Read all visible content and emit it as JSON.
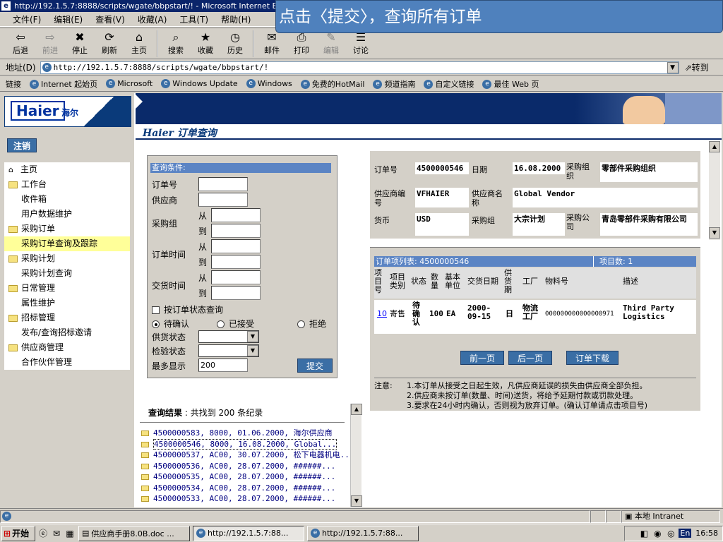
{
  "window": {
    "title": "http://192.1.5.7:8888/scripts/wgate/bbpstart/! - Microsoft Internet Explorer"
  },
  "callout": {
    "text": "点击〈提交〉，查询所有订单"
  },
  "menu": [
    "文件(F)",
    "编辑(E)",
    "查看(V)",
    "收藏(A)",
    "工具(T)",
    "帮助(H)"
  ],
  "toolbar": [
    {
      "label": "后退",
      "icon": "back-arrow-icon",
      "glyph": "⇦"
    },
    {
      "label": "前进",
      "icon": "forward-arrow-icon",
      "glyph": "⇨"
    },
    {
      "label": "停止",
      "icon": "stop-icon",
      "glyph": "✖"
    },
    {
      "label": "刷新",
      "icon": "refresh-icon",
      "glyph": "⟳"
    },
    {
      "label": "主页",
      "icon": "home-icon",
      "glyph": "⌂"
    },
    {
      "label": "搜索",
      "icon": "search-icon",
      "glyph": "⌕"
    },
    {
      "label": "收藏",
      "icon": "favorites-icon",
      "glyph": "★"
    },
    {
      "label": "历史",
      "icon": "history-icon",
      "glyph": "◷"
    },
    {
      "label": "邮件",
      "icon": "mail-icon",
      "glyph": "✉"
    },
    {
      "label": "打印",
      "icon": "print-icon",
      "glyph": "⎙"
    },
    {
      "label": "编辑",
      "icon": "edit-icon",
      "glyph": "✎"
    },
    {
      "label": "讨论",
      "icon": "discuss-icon",
      "glyph": "☰"
    }
  ],
  "address": {
    "label": "地址(D)",
    "url": "http://192.1.5.7:8888/scripts/wgate/bbpstart/!",
    "go": "转到"
  },
  "links": {
    "label": "链接",
    "items": [
      "Internet 起始页",
      "Microsoft",
      "Windows Update",
      "Windows",
      "免费的HotMail",
      "频道指南",
      "自定义链接",
      "最佳 Web 页"
    ]
  },
  "brand": {
    "logo": "Haier",
    "logo_cn": "海尔",
    "subtitle": "Haier 订单查询"
  },
  "sidebar": {
    "logout": "注销",
    "items": [
      {
        "label": "主页",
        "level": 0,
        "kind": "home"
      },
      {
        "label": "工作台",
        "level": 0,
        "kind": "folder"
      },
      {
        "label": "收件箱",
        "level": 1
      },
      {
        "label": "用户数据维护",
        "level": 1
      },
      {
        "label": "采购订单",
        "level": 0,
        "kind": "folder"
      },
      {
        "label": "采购订单查询及跟踪",
        "level": 1,
        "selected": true
      },
      {
        "label": "采购计划",
        "level": 0,
        "kind": "folder"
      },
      {
        "label": "采购计划查询",
        "level": 1
      },
      {
        "label": "日常管理",
        "level": 0,
        "kind": "folder"
      },
      {
        "label": "属性维护",
        "level": 1
      },
      {
        "label": "招标管理",
        "level": 0,
        "kind": "folder"
      },
      {
        "label": "发布/查询招标邀请",
        "level": 1
      },
      {
        "label": "供应商管理",
        "level": 0,
        "kind": "folder"
      },
      {
        "label": "合作伙伴管理",
        "level": 1
      }
    ]
  },
  "query": {
    "header": "查询条件:",
    "order_no": "订单号",
    "supplier": "供应商",
    "purch_group": "采购组",
    "order_time": "订单时间",
    "delivery_time": "交货时间",
    "from": "从",
    "to": "到",
    "by_status": "按订单状态查询",
    "radios": [
      "待确认",
      "已接受",
      "拒绝"
    ],
    "supply_status": "供货状态",
    "inspect_status": "检验状态",
    "max_show": "最多显示",
    "max_value": "200",
    "submit": "提交"
  },
  "results": {
    "title": "查询结果",
    "summary": ": 共找到 200 条纪录",
    "items": [
      "4500000583, 8000, 01.06.2000, 海尔供应商",
      "4500000546, 8000, 16.08.2000, Global...",
      "4500000537, AC00, 30.07.2000, 松下电器机电...",
      "4500000536, AC00, 28.07.2000, ######...",
      "4500000535, AC00, 28.07.2000, ######...",
      "4500000534, AC00, 28.07.2000, ######...",
      "4500000533, AC00, 28.07.2000, ######..."
    ]
  },
  "order": {
    "order_no_label": "订单号",
    "order_no": "4500000546",
    "date_label": "日期",
    "date": "16.08.2000",
    "porg_label": "采购组织",
    "porg": "零部件采购组织",
    "vendor_no_label": "供应商编号",
    "vendor_no": "VFHAIER",
    "vendor_name_label": "供应商名称",
    "vendor_name": "Global Vendor",
    "currency_label": "货币",
    "currency": "USD",
    "pgroup_label": "采购组",
    "pgroup": "大宗计划",
    "company_label": "采购公司",
    "company": "青岛零部件采购有限公司"
  },
  "items": {
    "header": "订单项列表: 4500000546",
    "count": "项目数: 1",
    "columns": [
      "项目号",
      "项目类别",
      "状态",
      "数量",
      "基本单位",
      "交货日期",
      "供货期",
      "工厂",
      "物料号",
      "描述"
    ],
    "row": {
      "item": "10",
      "category": "寄售",
      "status": "待确认",
      "qty": "100",
      "unit": "EA",
      "date": "2000-09-15",
      "period": "日",
      "plant": "物流工厂",
      "material": "000000000000000971",
      "desc": "Third Party Logistics"
    },
    "buttons": [
      "前一页",
      "后一页",
      "订单下载"
    ],
    "note_label": "注意:",
    "notes": [
      "1.本订单从接受之日起生效，凡供应商延误的损失由供应商全部负担。",
      "2.供应商未按订单(数量、时间)送货，将给予延期付款或罚款处理。",
      "3.要求在24小时内确认，否则视为放弃订单。(确认订单请点击项目号)"
    ]
  },
  "status": {
    "zone": "本地 Intranet"
  },
  "taskbar": {
    "start": "开始",
    "tasks": [
      "供应商手册8.0B.doc ...",
      "http://192.1.5.7:88...",
      "http://192.1.5.7:88..."
    ],
    "time": "16:58",
    "lang": "En"
  }
}
